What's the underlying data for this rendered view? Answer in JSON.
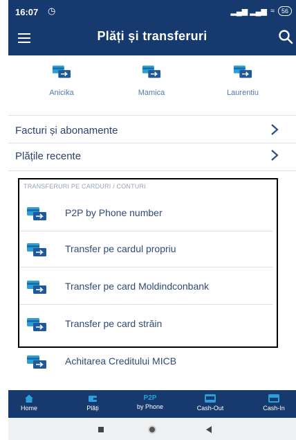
{
  "status_bar": {
    "time": "16:07",
    "alarm_icon": "alarm-icon",
    "signal": "▂▄▆ ▂▄▆",
    "battery": "56"
  },
  "app_bar": {
    "title": "Plăți și transferuri",
    "menu_icon": "hamburger-menu-icon",
    "search_icon": "search-icon"
  },
  "favorites": [
    {
      "label": "Anicika",
      "icon": "card-transfer-icon"
    },
    {
      "label": "Mamica",
      "icon": "card-transfer-icon"
    },
    {
      "label": "Laurentiu",
      "icon": "card-transfer-icon"
    }
  ],
  "links": [
    {
      "label": "Facturi și abonamente",
      "icon": "chevron-right-icon"
    },
    {
      "label": "Plățile recente",
      "icon": "chevron-right-icon"
    }
  ],
  "transfer_section": {
    "header": "TRANSFERURI PE CARDURI / CONTURI",
    "items": [
      {
        "label": "P2P by Phone number",
        "icon": "card-transfer-icon"
      },
      {
        "label": "Transfer pe cardul propriu",
        "icon": "card-transfer-icon"
      },
      {
        "label": "Transfer pe card Moldindconbank",
        "icon": "card-transfer-icon"
      },
      {
        "label": "Transfer pe card străin",
        "icon": "card-transfer-icon"
      }
    ]
  },
  "extra_item": {
    "label": "Achitarea Creditului MICB",
    "icon": "card-transfer-icon"
  },
  "bottom_nav": [
    {
      "label": "Home",
      "icon": "home-icon"
    },
    {
      "label": "Plăți",
      "icon": "wallet-icon"
    },
    {
      "top": "P2P",
      "label": "by Phone"
    },
    {
      "label": "Cash-Out",
      "icon": "cash-out-icon"
    },
    {
      "label": "Cash-In",
      "icon": "cash-in-icon"
    }
  ],
  "colors": {
    "brand": "#163a6e",
    "accent": "#2a9fd8",
    "link_text": "#2c4370"
  }
}
